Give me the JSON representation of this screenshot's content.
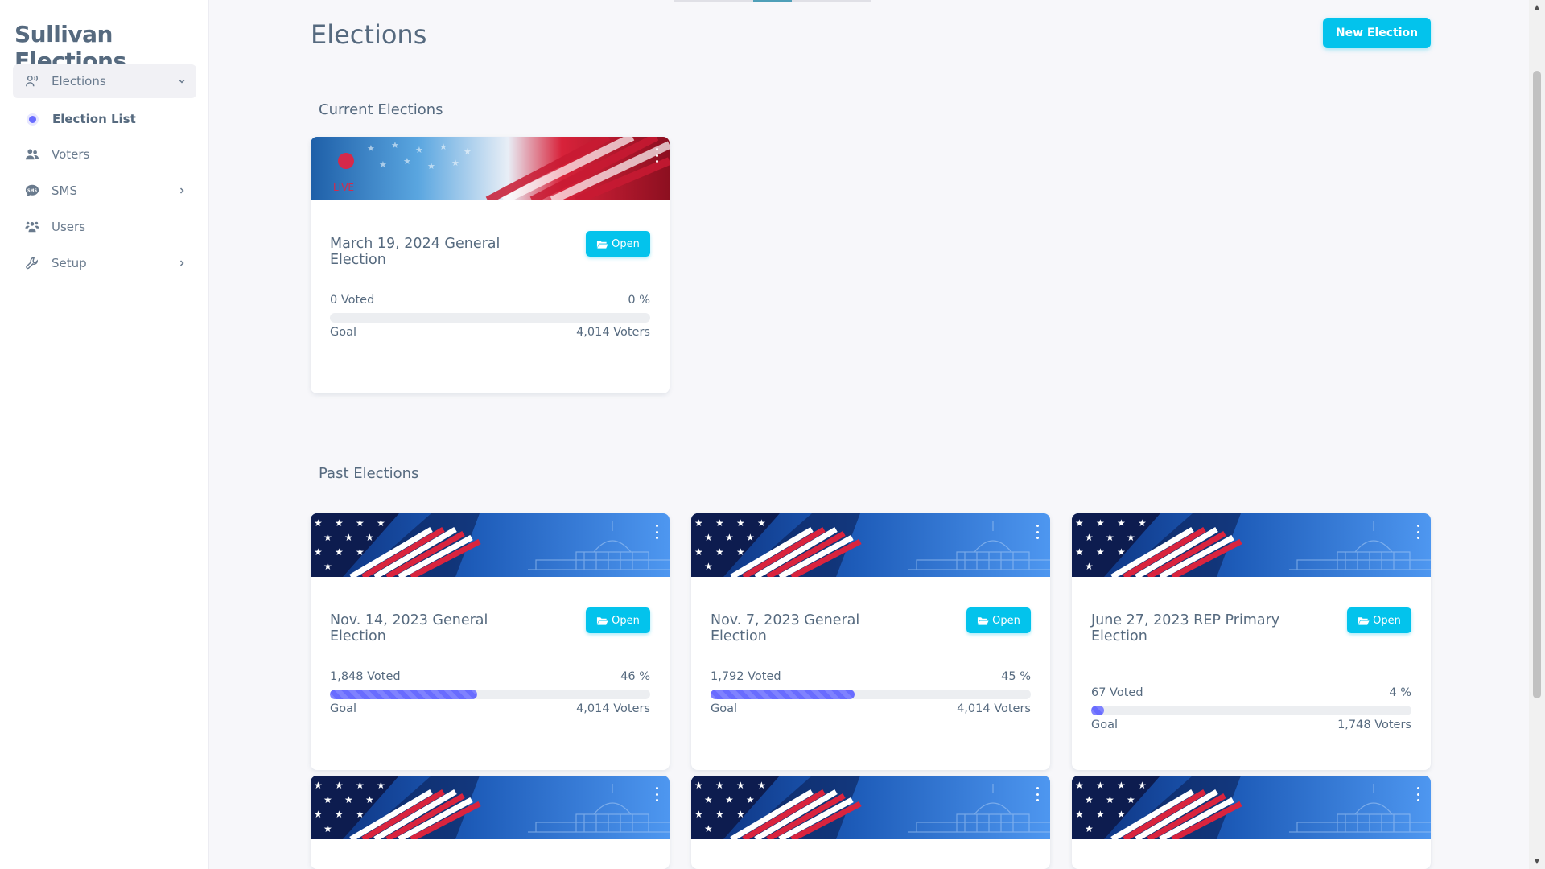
{
  "brand": "Sullivan Elections",
  "nav": {
    "elections": "Elections",
    "election_list": "Election List",
    "voters": "Voters",
    "sms": "SMS",
    "users": "Users",
    "setup": "Setup"
  },
  "page": {
    "title": "Elections",
    "new_button": "New Election",
    "current_section": "Current Elections",
    "past_section": "Past Elections"
  },
  "open_label": "Open",
  "goal_label": "Goal",
  "live_label": "LIVE",
  "colors": {
    "accent": "#03c3ec",
    "progress": "#696cff",
    "live": "#d6294a"
  },
  "current_elections": [
    {
      "title": "March 19, 2024 General Election",
      "voted": "0 Voted",
      "percent": "0 %",
      "progress": 0,
      "goal": "4,014 Voters"
    }
  ],
  "past_elections": [
    {
      "title": "Nov. 14, 2023 General Election",
      "voted": "1,848 Voted",
      "percent": "46 %",
      "progress": 46,
      "goal": "4,014 Voters"
    },
    {
      "title": "Nov. 7, 2023 General Election",
      "voted": "1,792 Voted",
      "percent": "45 %",
      "progress": 45,
      "goal": "4,014 Voters"
    },
    {
      "title": "June 27, 2023 REP Primary Election",
      "voted": "67 Voted",
      "percent": "4 %",
      "progress": 4,
      "goal": "1,748 Voters"
    }
  ]
}
